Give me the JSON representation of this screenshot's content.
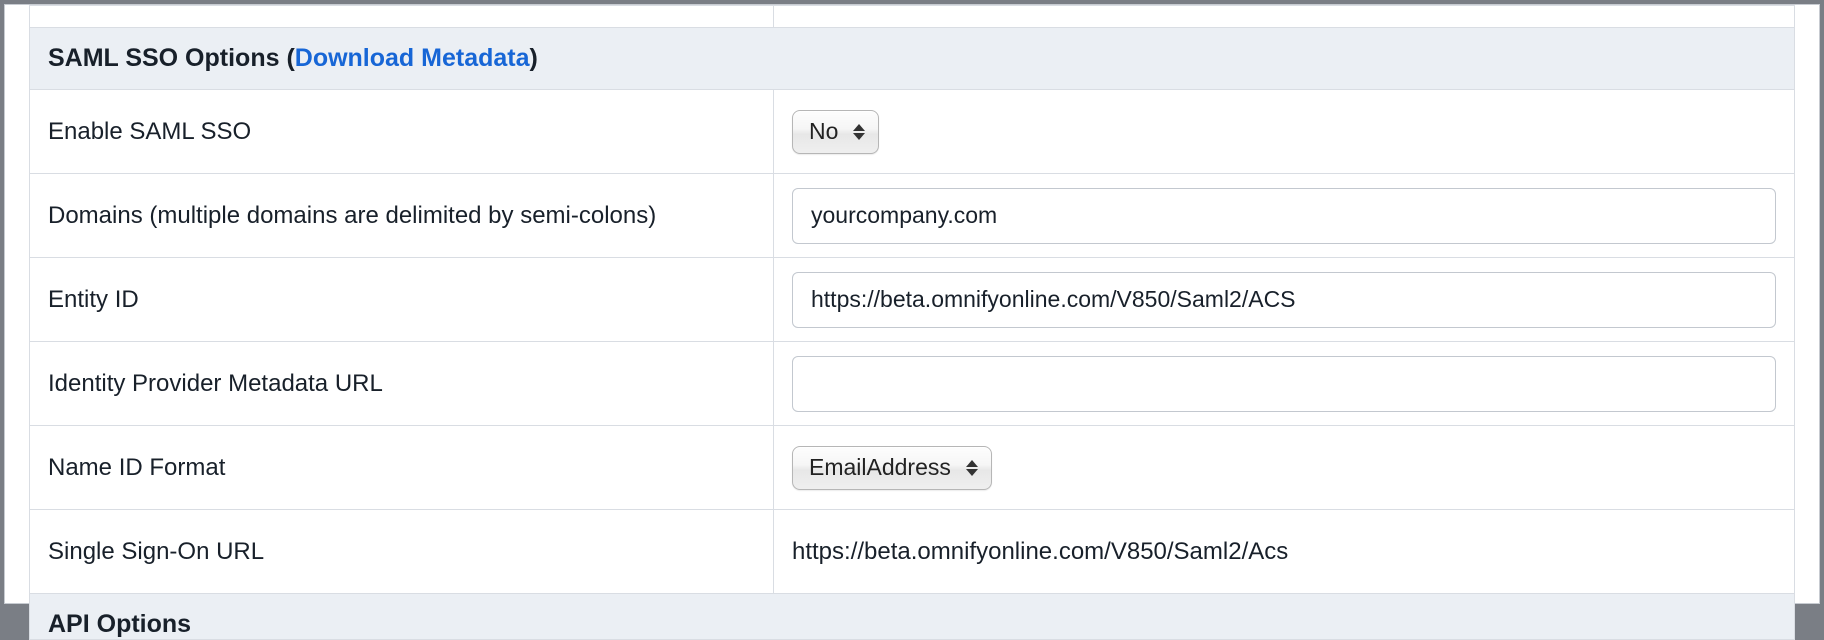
{
  "sections": {
    "saml": {
      "header_prefix": "SAML SSO Options (",
      "header_link": "Download Metadata",
      "header_suffix": ")"
    },
    "api": {
      "header": "API Options"
    }
  },
  "rows": {
    "enable_saml": {
      "label": "Enable SAML SSO",
      "value": "No"
    },
    "domains": {
      "label": "Domains (multiple domains are delimited by semi-colons)",
      "value": "yourcompany.com"
    },
    "entity_id": {
      "label": "Entity ID",
      "value": "https://beta.omnifyonline.com/V850/Saml2/ACS"
    },
    "idp_metadata": {
      "label": "Identity Provider Metadata URL",
      "value": ""
    },
    "name_id_format": {
      "label": "Name ID Format",
      "value": "EmailAddress"
    },
    "sso_url": {
      "label": "Single Sign-On URL",
      "value": "https://beta.omnifyonline.com/V850/Saml2/Acs"
    }
  }
}
